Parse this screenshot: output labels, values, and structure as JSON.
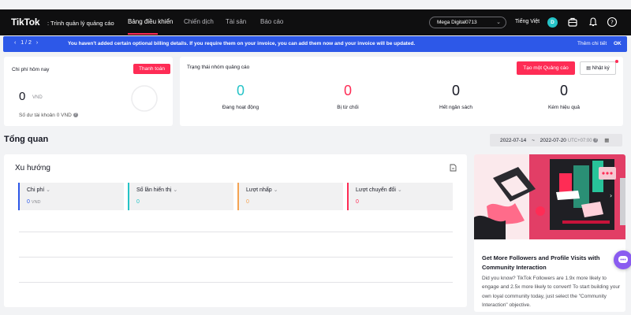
{
  "header": {
    "logo": "TikTok",
    "logo_sub": ": Trình quản lý quảng cáo",
    "nav": [
      "Bảng điều khiển",
      "Chiến dịch",
      "Tài sản",
      "Báo cáo"
    ],
    "account": "Mega Digital0713",
    "language": "Tiếng Việt",
    "avatar_initial": "D"
  },
  "banner": {
    "pager": "1 / 2",
    "message": "You haven't added certain optional billing details. If you require them on your invoice, you can add them now and your invoice will be updated.",
    "detail_link": "Thêm chi tiết",
    "ok": "OK"
  },
  "cost_card": {
    "title": "Chi phí hôm nay",
    "pay_button": "Thanh toán",
    "amount": "0",
    "unit": "VND",
    "balance": "Số dư tài khoản 0 VND"
  },
  "status_card": {
    "title": "Trạng thái nhóm quảng cáo",
    "create_button": "Tạo một Quảng cáo",
    "log_button": "Nhật ký",
    "stats": [
      {
        "value": "0",
        "label": "Đang hoạt động",
        "color": "#25c3c7"
      },
      {
        "value": "0",
        "label": "Bị từ chối",
        "color": "#fe2c55"
      },
      {
        "value": "0",
        "label": "Hết ngân sách",
        "color": "#161823"
      },
      {
        "value": "0",
        "label": "Kém hiệu quả",
        "color": "#161823"
      }
    ]
  },
  "overview": {
    "title": "Tổng quan",
    "date_start": "2022-07-14",
    "date_sep": "~",
    "date_end": "2022-07-20",
    "timezone": "UTC+07:00"
  },
  "trend": {
    "title": "Xu hướng",
    "metrics": [
      {
        "label": "Chi phí",
        "value": "0",
        "unit": "VND",
        "color": "#2d58e8"
      },
      {
        "label": "Số lần hiển thị",
        "value": "0",
        "unit": "",
        "color": "#25c3c7"
      },
      {
        "label": "Lượt nhấp",
        "value": "0",
        "unit": "",
        "color": "#f5a352"
      },
      {
        "label": "Lượt chuyển đổi",
        "value": "0",
        "unit": "",
        "color": "#fe2c55"
      }
    ]
  },
  "promo": {
    "title": "Get More Followers and Profile Visits with Community Interaction",
    "body": "Did you know? TikTok Followers are 1.9x more likely to engage and 2.5x more likely to convert! To start building your own loyal community today, just select the \"Community Interaction\" objective."
  },
  "colors": {
    "brand_red": "#fe2c55",
    "accent_blue": "#2d58e8",
    "accent_teal": "#25c3c7"
  }
}
